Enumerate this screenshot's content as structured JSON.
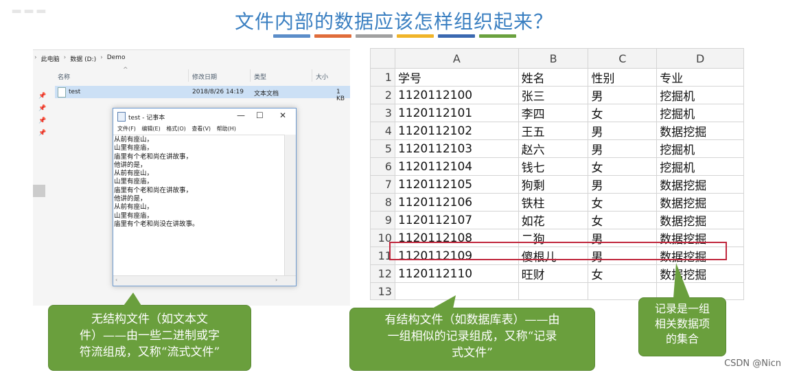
{
  "title": "文件内部的数据应该怎样组织起来？",
  "color_bars": [
    "#5b8dc9",
    "#e06c3a",
    "#a0a0a0",
    "#f0b428",
    "#3a68b0",
    "#6aa13e"
  ],
  "explorer": {
    "breadcrumb": [
      "此电脑",
      "数据 (D:)",
      "Demo"
    ],
    "columns": {
      "name": "名称",
      "modified": "修改日期",
      "type": "类型",
      "size": "大小"
    },
    "file": {
      "name": "test",
      "modified": "2018/8/26 14:19",
      "type": "文本文档",
      "size": "1 KB"
    }
  },
  "notepad": {
    "title": "test - 记事本",
    "controls": {
      "minimize": "—",
      "maximize": "☐",
      "close": "✕"
    },
    "menu": [
      "文件(F)",
      "编辑(E)",
      "格式(O)",
      "查看(V)",
      "帮助(H)"
    ],
    "lines": [
      "从前有座山，",
      "山里有座庙，",
      "庙里有个老和尚在讲故事，",
      "他讲的是，",
      "从前有座山，",
      "山里有座庙，",
      "庙里有个老和尚在讲故事，",
      "他讲的是，",
      "从前有座山，",
      "山里有座庙，",
      "庙里有个老和尚没在讲故事。"
    ]
  },
  "sheet": {
    "col_letters": [
      "A",
      "B",
      "C",
      "D"
    ],
    "row_numbers": [
      "1",
      "2",
      "3",
      "4",
      "5",
      "6",
      "7",
      "8",
      "9",
      "10",
      "11",
      "12",
      "13"
    ],
    "rows": [
      [
        "学号",
        "姓名",
        "性别",
        "专业"
      ],
      [
        "1120112100",
        "张三",
        "男",
        "挖掘机"
      ],
      [
        "1120112101",
        "李四",
        "女",
        "挖掘机"
      ],
      [
        "1120112102",
        "王五",
        "男",
        "数据挖掘"
      ],
      [
        "1120112103",
        "赵六",
        "男",
        "挖掘机"
      ],
      [
        "1120112104",
        "钱七",
        "女",
        "挖掘机"
      ],
      [
        "1120112105",
        "狗剩",
        "男",
        "数据挖掘"
      ],
      [
        "1120112106",
        "铁柱",
        "女",
        "数据挖掘"
      ],
      [
        "1120112107",
        "如花",
        "女",
        "数据挖掘"
      ],
      [
        "1120112108",
        "二狗",
        "男",
        "数据挖掘"
      ],
      [
        "1120112109",
        "傻根儿",
        "男",
        "数据挖掘"
      ],
      [
        "1120112110",
        "旺财",
        "女",
        "数据挖掘"
      ],
      [
        "",
        "",
        "",
        ""
      ]
    ],
    "highlight_color": "#c0263c"
  },
  "callouts": {
    "unstructured": [
      "无结构文件（如文本文",
      "件）——由一些二进制或字",
      "符流组成，又称“流式文件”"
    ],
    "structured": [
      "有结构文件（如数据库表）——由",
      "一组相似的记录组成，又称“记录",
      "式文件”"
    ],
    "record": [
      "记录是一组",
      "相关数据项",
      "的集合"
    ],
    "fill_color": "#6a9f3d"
  },
  "watermark": "CSDN @Nicn"
}
